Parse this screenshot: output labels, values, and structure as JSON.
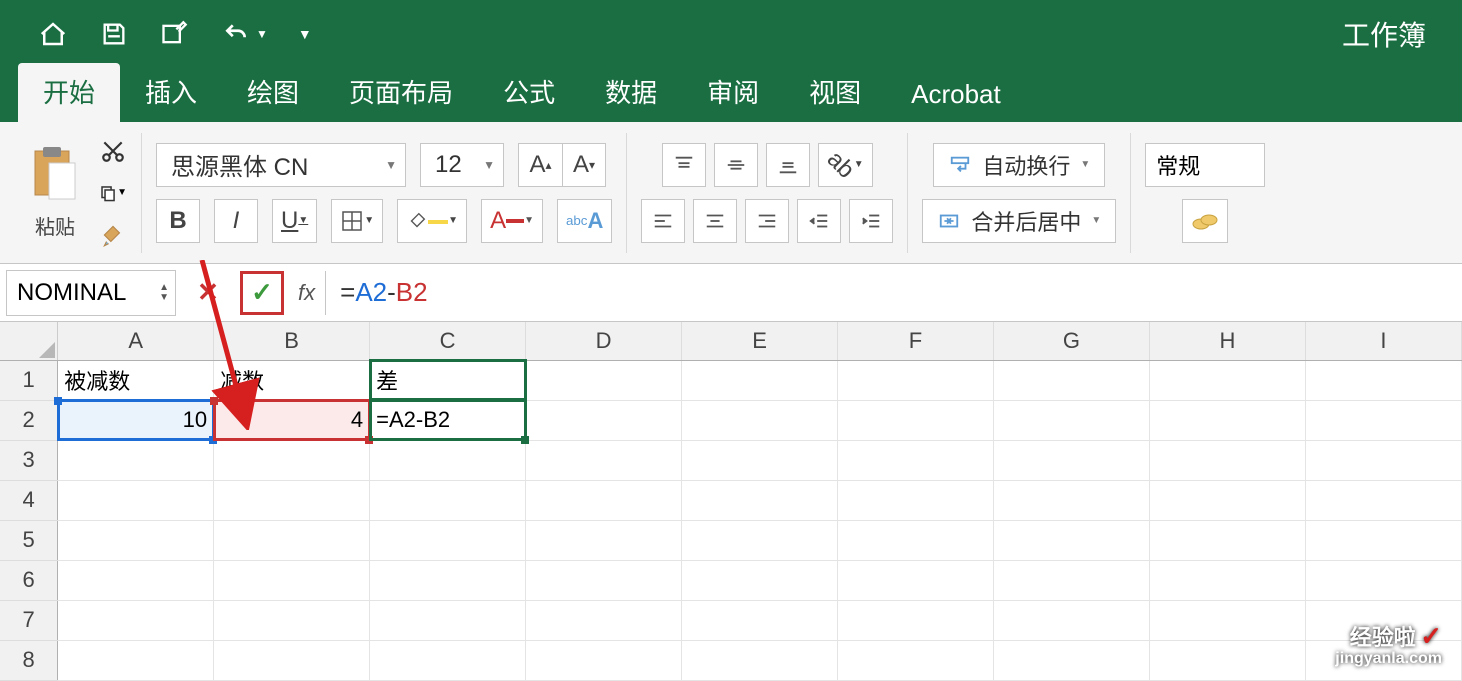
{
  "app": {
    "title": "工作簿"
  },
  "tabs": [
    "开始",
    "插入",
    "绘图",
    "页面布局",
    "公式",
    "数据",
    "审阅",
    "视图",
    "Acrobat"
  ],
  "ribbon": {
    "paste_label": "粘贴",
    "font_name": "思源黑体 CN",
    "font_size": "12",
    "wrap_label": "自动换行",
    "merge_label": "合并后居中",
    "number_format": "常规"
  },
  "formula_bar": {
    "name_box": "NOMINAL",
    "fx_label": "fx",
    "formula_eq": "=",
    "formula_ref1": "A2",
    "formula_minus": "-",
    "formula_ref2": "B2"
  },
  "grid": {
    "columns": [
      "A",
      "B",
      "C",
      "D",
      "E",
      "F",
      "G",
      "H",
      "I"
    ],
    "rows": [
      "1",
      "2",
      "3",
      "4",
      "5",
      "6",
      "7",
      "8"
    ],
    "data": {
      "r1": {
        "A": "被减数",
        "B": "减数",
        "C": "差"
      },
      "r2": {
        "A": "10",
        "B": "4",
        "C": "=A2-B2"
      }
    }
  },
  "watermark": {
    "cn": "经验啦",
    "en": "jingyanla.com"
  }
}
